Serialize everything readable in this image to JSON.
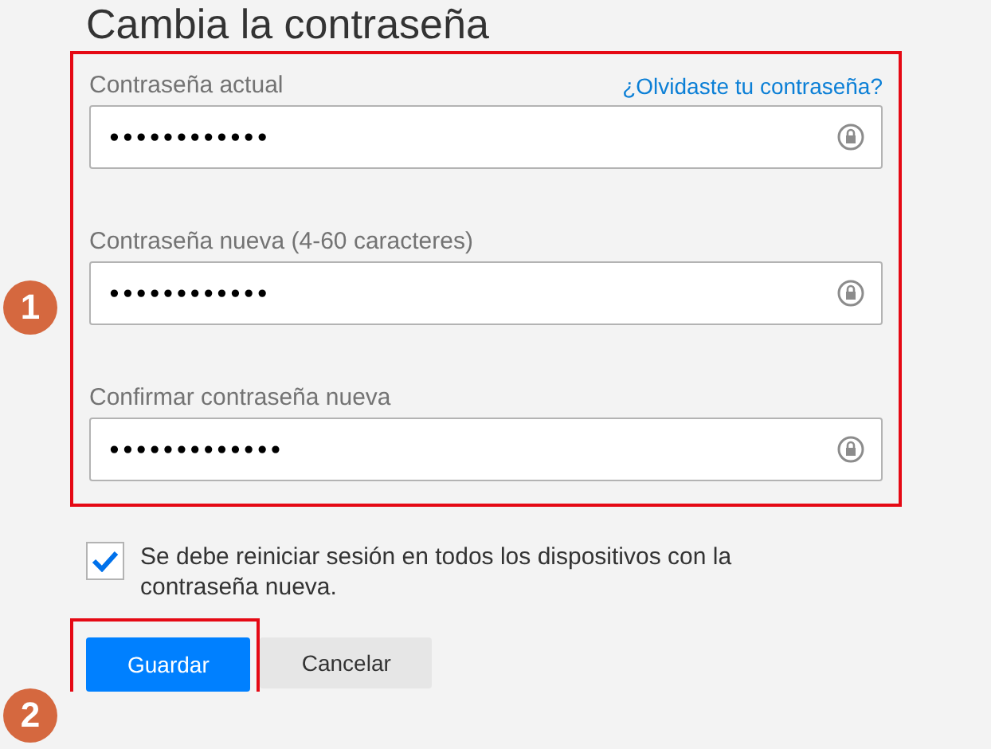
{
  "title": "Cambia la contraseña",
  "fields": [
    {
      "label": "Contraseña actual",
      "link": "¿Olvidaste tu contraseña?",
      "value": "••••••••••••"
    },
    {
      "label": "Contraseña nueva (4-60 caracteres)",
      "value": "••••••••••••"
    },
    {
      "label": "Confirmar contraseña nueva",
      "value": "•••••••••••••"
    }
  ],
  "checkbox": {
    "label": "Se debe reiniciar sesión en todos los dispositivos con la contraseña nueva.",
    "checked": true
  },
  "buttons": [
    {
      "label": "Guardar",
      "kind": "primary"
    },
    {
      "label": "Cancelar",
      "kind": "secondary"
    }
  ],
  "markers": [
    "1",
    "2"
  ]
}
